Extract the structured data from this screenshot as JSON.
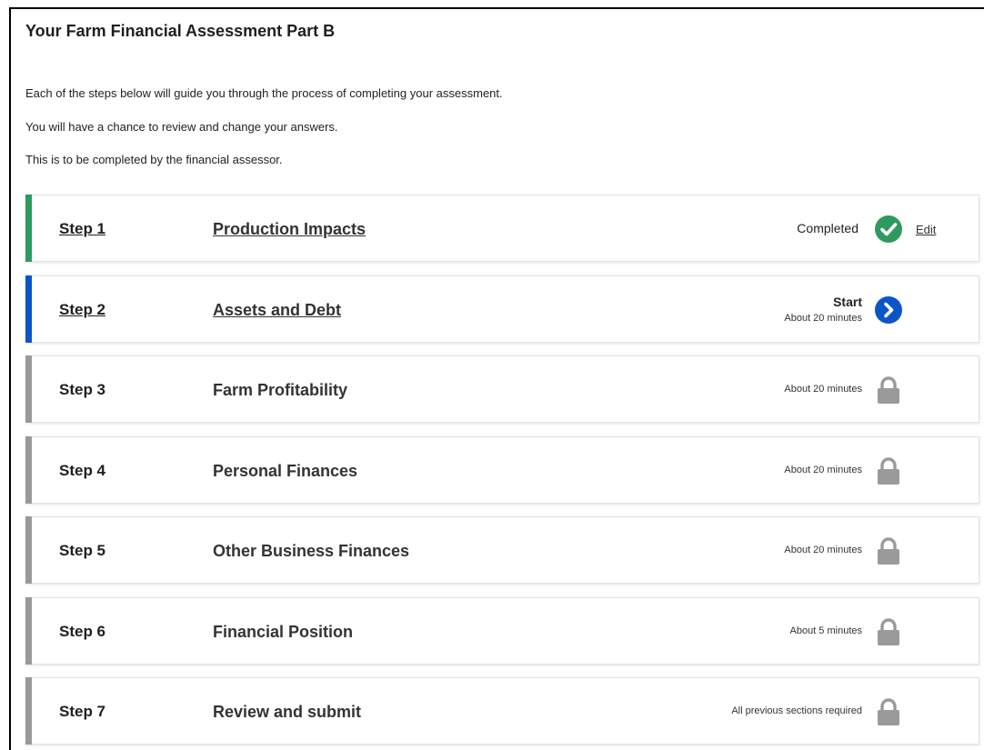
{
  "page": {
    "title": "Your Farm Financial Assessment Part B",
    "intro": [
      "Each of the steps below will guide you through the process of completing your assessment.",
      "You will have a chance to review and change your answers.",
      "This is to be completed by the financial assessor."
    ]
  },
  "colors": {
    "completed": "#2e9a5e",
    "active": "#0b55c6",
    "locked": "#9a9a9a"
  },
  "steps": [
    {
      "label": "Step 1",
      "title": "Production Impacts",
      "status": "Completed",
      "time": "",
      "state": "completed",
      "icon": "check-circle-icon",
      "action": "Edit"
    },
    {
      "label": "Step 2",
      "title": "Assets and Debt",
      "status": "Start",
      "time": "About 20 minutes",
      "state": "active",
      "icon": "chevron-right-circle-icon",
      "action": ""
    },
    {
      "label": "Step 3",
      "title": "Farm Profitability",
      "status": "",
      "time": "About 20 minutes",
      "state": "locked",
      "icon": "lock-icon",
      "action": ""
    },
    {
      "label": "Step 4",
      "title": "Personal Finances",
      "status": "",
      "time": "About 20 minutes",
      "state": "locked",
      "icon": "lock-icon",
      "action": ""
    },
    {
      "label": "Step 5",
      "title": "Other Business Finances",
      "status": "",
      "time": "About 20 minutes",
      "state": "locked",
      "icon": "lock-icon",
      "action": ""
    },
    {
      "label": "Step 6",
      "title": "Financial Position",
      "status": "",
      "time": "About 5 minutes",
      "state": "locked",
      "icon": "lock-icon",
      "action": ""
    },
    {
      "label": "Step 7",
      "title": "Review and submit",
      "status": "",
      "time": "All previous sections required",
      "state": "locked",
      "icon": "lock-icon",
      "action": ""
    }
  ]
}
